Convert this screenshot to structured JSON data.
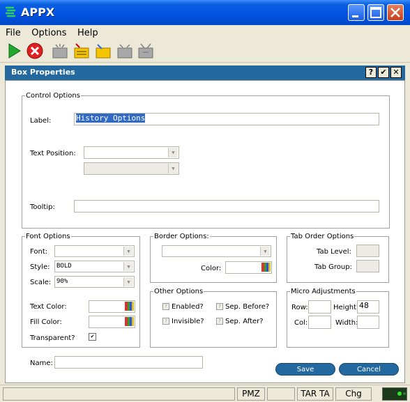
{
  "window": {
    "title": "APPX"
  },
  "menu": {
    "items": [
      "File",
      "Options",
      "Help"
    ]
  },
  "toolbar": {
    "icons": [
      "run-icon",
      "stop-icon",
      "folder-new-icon",
      "edit-icon",
      "folder-open-icon",
      "folder-icon",
      "inbox-icon"
    ]
  },
  "dialog": {
    "title": "Box Properties",
    "help_label": "?",
    "ok_label": "✔",
    "close_label": "✕"
  },
  "control_options": {
    "legend": "Control Options",
    "label_caption": "Label:",
    "label_value": "History Options",
    "text_position_caption": "Text Position:",
    "text_position_value": "",
    "text_position2_value": "",
    "tooltip_caption": "Tooltip:",
    "tooltip_value": ""
  },
  "font_options": {
    "legend": "Font Options",
    "font_caption": "Font:",
    "font_value": "",
    "style_caption": "Style:",
    "style_value": "BOLD",
    "scale_caption": "Scale:",
    "scale_value": "90%",
    "text_color_caption": "Text Color:",
    "fill_color_caption": "Fill Color:",
    "transparent_caption": "Transparent?",
    "transparent_checked": "✔"
  },
  "border_options": {
    "legend": "Border Options:",
    "style_value": "",
    "color_caption": "Color:"
  },
  "tab_order_options": {
    "legend": "Tab Order Options",
    "tab_level_caption": "Tab Level:",
    "tab_group_caption": "Tab Group:"
  },
  "other_options": {
    "legend": "Other Options",
    "enabled_caption": "Enabled?",
    "invisible_caption": "Invisible?",
    "sep_before_caption": "Sep. Before?",
    "sep_after_caption": "Sep. After?",
    "check_mark": "?"
  },
  "micro_adjustments": {
    "legend": "Micro Adjustments",
    "row_caption": "Row:",
    "col_caption": "Col:",
    "height_caption": "Height:",
    "height_value": "48",
    "width_caption": "Width:"
  },
  "bottom": {
    "name_caption": "Name:",
    "name_value": "",
    "save_label": "Save",
    "cancel_label": "Cancel"
  },
  "statusbar": {
    "segments": [
      "",
      "PMZ",
      "",
      "TAR TA",
      "Chg"
    ]
  },
  "colors": {
    "accent": "#23689f",
    "titlebar": "#0054e3",
    "selection": "#316ac5"
  }
}
